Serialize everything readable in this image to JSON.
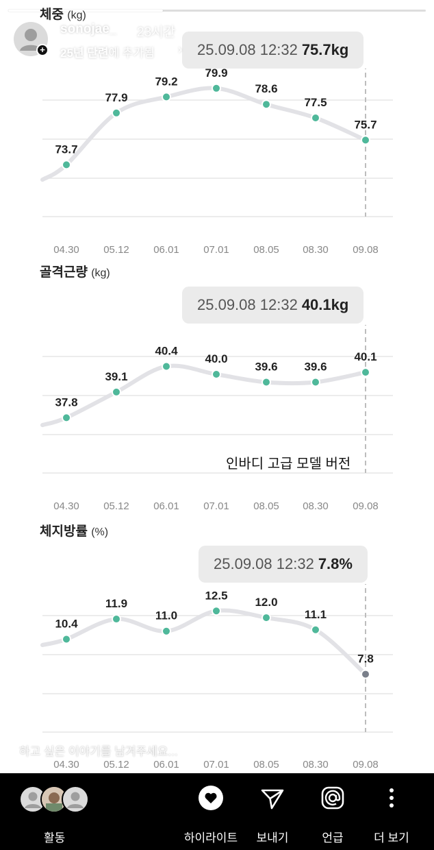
{
  "story": {
    "progress": 0.37,
    "username": "sonojae_",
    "time_ago": "23시간",
    "added_to_highlight": "25년 단련",
    "added_to_suffix": "에 추가됨",
    "reply_placeholder": "하고 싶은 이야기를 남겨주세요..."
  },
  "sections": [
    {
      "title": "체중",
      "unit": "(kg)",
      "tooltip_time": "25.09.08 12:32",
      "tooltip_value": "75.7kg"
    },
    {
      "title": "골격근량",
      "unit": "(kg)",
      "tooltip_time": "25.09.08 12:32",
      "tooltip_value": "40.1kg"
    },
    {
      "title": "체지방률",
      "unit": "(%)",
      "tooltip_time": "25.09.08 12:32",
      "tooltip_value": "7.8%"
    }
  ],
  "note": "인바디 고급 모델 버전",
  "chart_data": [
    {
      "type": "line",
      "title": "체중",
      "ylabel": "(kg)",
      "categories": [
        "04.30",
        "05.12",
        "06.01",
        "07.01",
        "08.05",
        "08.30",
        "09.08"
      ],
      "values": [
        73.7,
        77.9,
        79.2,
        79.9,
        78.6,
        77.5,
        75.7
      ],
      "data_labels": [
        "73.7",
        "77.9",
        "79.2",
        "79.9",
        "78.6",
        "77.5",
        "75.7"
      ],
      "ylim": [
        69.5,
        81.5
      ],
      "grid": true,
      "selected_index": 6
    },
    {
      "type": "line",
      "title": "골격근량",
      "ylabel": "(kg)",
      "categories": [
        "04.30",
        "05.12",
        "06.01",
        "07.01",
        "08.05",
        "08.30",
        "09.08"
      ],
      "values": [
        37.8,
        39.1,
        40.4,
        40.0,
        39.6,
        39.6,
        40.1
      ],
      "data_labels": [
        "37.8",
        "39.1",
        "40.4",
        "40.0",
        "39.6",
        "39.6",
        "40.1"
      ],
      "ylim": [
        35.0,
        42.5
      ],
      "grid": true,
      "selected_index": 6
    },
    {
      "type": "line",
      "title": "체지방률",
      "ylabel": "(%)",
      "categories": [
        "04.30",
        "05.12",
        "06.01",
        "07.01",
        "08.05",
        "08.30",
        "09.08"
      ],
      "values": [
        10.4,
        11.9,
        11.0,
        12.5,
        12.0,
        11.1,
        7.8
      ],
      "data_labels": [
        "10.4",
        "11.9",
        "11.0",
        "12.5",
        "12.0",
        "11.1",
        "7.8"
      ],
      "ylim": [
        3.5,
        14.5
      ],
      "grid": true,
      "selected_index": 6
    }
  ],
  "bottom_bar": {
    "activity_label": "활동",
    "highlight_label": "하이라이트",
    "send_label": "보내기",
    "mention_label": "언급",
    "more_label": "더 보기"
  },
  "colors": {
    "point": "#4fb89a",
    "selected_point_last": "#7a7f8a",
    "line": "#e2e2e6",
    "grid": "#e6e6e6",
    "guide": "#bdbdbd"
  },
  "icons": {
    "heart": "heart-icon",
    "send": "paper-plane-icon",
    "mention": "at-icon",
    "more": "more-vertical-icon"
  }
}
